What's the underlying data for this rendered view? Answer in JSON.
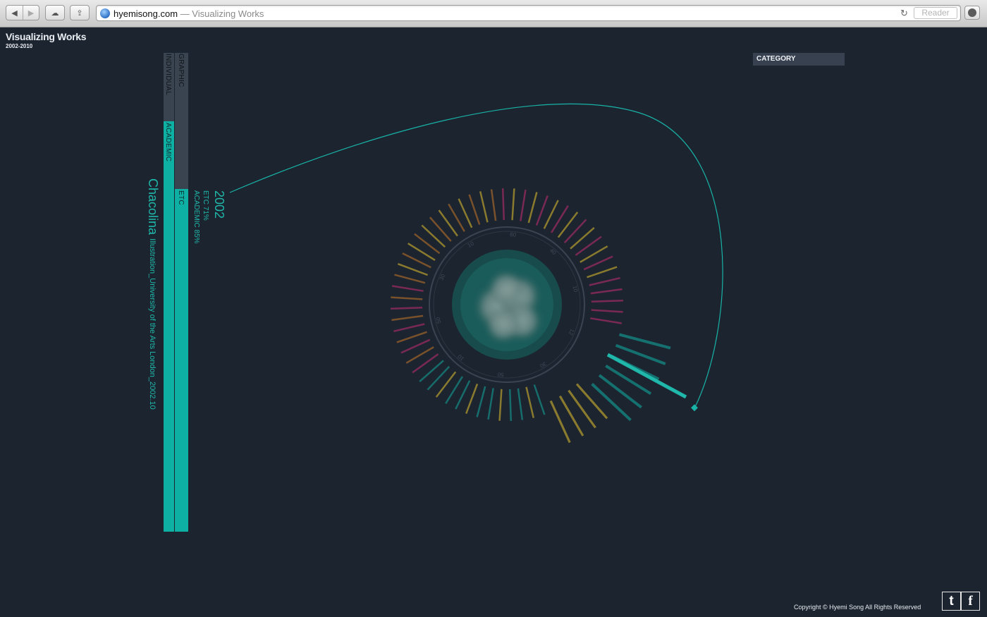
{
  "browser": {
    "domain": "hyemisong.com",
    "separator": " — ",
    "page_title": "Visualizing Works",
    "reader_label": "Reader"
  },
  "header": {
    "title": "Visualizing Works",
    "years": "2002-2010"
  },
  "category_label": "CATEGORY",
  "bars": [
    {
      "top_label": "INDIVIDUAL",
      "bottom_label": "ACADEMIC"
    },
    {
      "top_label": "GRAPHIC",
      "bottom_label": "ETC"
    }
  ],
  "work": {
    "title": "Chacolina",
    "description": "Illustration_University of the Arts London_2002.10",
    "year": "2002",
    "stats": [
      "ETC 71%",
      "ACADEMIC 85%"
    ]
  },
  "dial": {
    "ticks": [
      "60",
      "40",
      "10",
      "12",
      "30",
      "50",
      "10",
      "50",
      "30",
      "10"
    ]
  },
  "colors": {
    "background": "#1c2430",
    "accent": "#1fb8aa",
    "bar_inactive": "#3a4350",
    "ray_magenta": "#8a2a5a",
    "ray_gold": "#9c8a2e",
    "ray_orange": "#8a5a2a",
    "ray_teal": "#157a76"
  },
  "footer": {
    "copyright": "Copyright © Hyemi Song All Rights Reserved",
    "twitter": "t",
    "facebook": "f"
  }
}
